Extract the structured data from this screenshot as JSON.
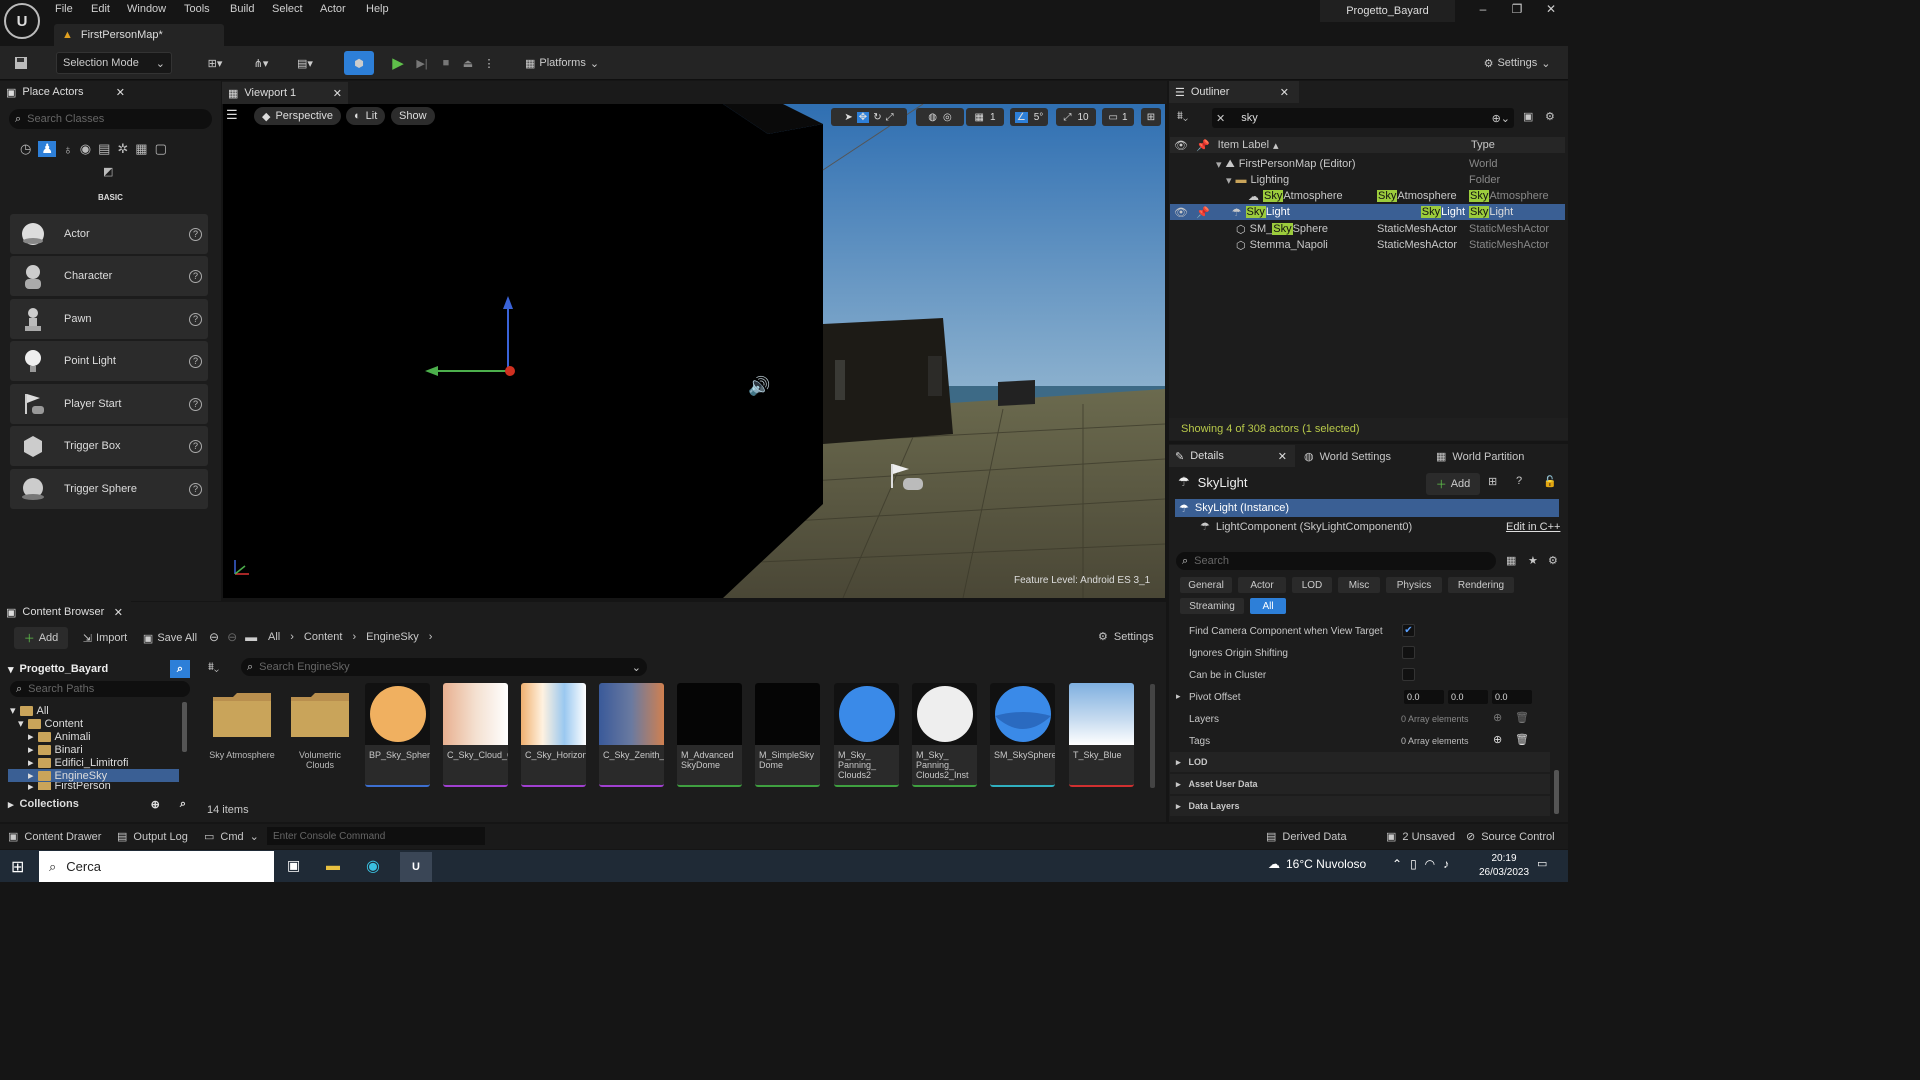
{
  "menu": [
    "File",
    "Edit",
    "Window",
    "Tools",
    "Build",
    "Select",
    "Actor",
    "Help"
  ],
  "project_name": "Progetto_Bayard",
  "map_tab": "FirstPersonMap*",
  "toolbar": {
    "selection_mode": "Selection Mode",
    "platforms": "Platforms",
    "settings": "Settings"
  },
  "place_actors": {
    "title": "Place Actors",
    "search_placeholder": "Search Classes",
    "category": "BASIC",
    "items": [
      {
        "label": "Actor"
      },
      {
        "label": "Character"
      },
      {
        "label": "Pawn"
      },
      {
        "label": "Point Light"
      },
      {
        "label": "Player Start"
      },
      {
        "label": "Trigger Box"
      },
      {
        "label": "Trigger Sphere"
      }
    ]
  },
  "viewport": {
    "tab": "Viewport 1",
    "perspective": "Perspective",
    "lit": "Lit",
    "show": "Show",
    "grid_value": "1",
    "angle_value": "5°",
    "scale_value": "10",
    "camera_value": "1",
    "feature_level": "Feature Level:  Android ES 3_1"
  },
  "outliner": {
    "title": "Outliner",
    "search_value": "sky",
    "col_label": "Item Label",
    "col_type": "Type",
    "rows": [
      {
        "pre": "",
        "hl": "",
        "post": "FirstPersonMap (Editor)",
        "type": "World",
        "tpre": "",
        "thl": "",
        "tpost": "World"
      },
      {
        "pre": "",
        "hl": "",
        "post": "Lighting",
        "type": "Folder",
        "tpre": "",
        "thl": "",
        "tpost": "Folder"
      },
      {
        "pre": "",
        "hl": "Sky",
        "post": "Atmosphere",
        "cls_hl": "Sky",
        "cls_post": "Atmosphere",
        "tpre": "",
        "thl": "Sky",
        "tpost": "Atmosphere"
      },
      {
        "pre": "",
        "hl": "Sky",
        "post": "Light",
        "cls_hl": "Sky",
        "cls_post": "Light",
        "tpre": "",
        "thl": "Sky",
        "tpost": "Light"
      },
      {
        "pre": "SM_",
        "hl": "Sky",
        "post": "Sphere",
        "cls": "StaticMeshActor",
        "tpost": "StaticMeshActor"
      },
      {
        "pre": "Stemma_Napoli",
        "hl": "",
        "post": "",
        "cls": "StaticMeshActor",
        "tpost": "StaticMeshActor"
      }
    ],
    "status": "Showing 4 of 308 actors (1 selected)"
  },
  "details": {
    "tab": "Details",
    "world_settings": "World Settings",
    "world_partition": "World Partition",
    "actor_name": "SkyLight",
    "add": "Add",
    "instance": "SkyLight (Instance)",
    "component": "LightComponent (SkyLightComponent0)",
    "edit_cpp": "Edit in C++",
    "search_placeholder": "Search",
    "filters": [
      "General",
      "Actor",
      "LOD",
      "Misc",
      "Physics",
      "Rendering",
      "Streaming",
      "All"
    ],
    "props": {
      "find_camera": "Find Camera Component when View Target",
      "ignores_origin": "Ignores Origin Shifting",
      "can_cluster": "Can be in Cluster",
      "pivot": "Pivot Offset",
      "layers": "Layers",
      "tags": "Tags",
      "array": "0 Array elements"
    },
    "pivot_values": [
      "0.0",
      "0.0",
      "0.0"
    ],
    "sections": [
      "LOD",
      "Asset User Data",
      "Data Layers"
    ]
  },
  "content_browser": {
    "title": "Content Browser",
    "add": "Add",
    "import": "Import",
    "save_all": "Save All",
    "path": [
      "All",
      "Content",
      "EngineSky"
    ],
    "settings": "Settings",
    "project": "Progetto_Bayard",
    "search_paths": "Search Paths",
    "search_assets": "Search EngineSky",
    "collections": "Collections",
    "item_count": "14 items",
    "tree": [
      "All",
      "Content",
      "Animali",
      "Binari",
      "Edifici_Limitrofi",
      "EngineSky",
      "FirstPerson"
    ],
    "folders": [
      {
        "name": "Sky Atmosphere"
      },
      {
        "name": "Volumetric Clouds"
      }
    ],
    "assets": [
      {
        "name": "BP_Sky_Sphere"
      },
      {
        "name": "C_Sky_Cloud_Color"
      },
      {
        "name": "C_Sky_Horizon_Color"
      },
      {
        "name": "C_Sky_Zenith_Color"
      },
      {
        "name": "M_Advanced SkyDome"
      },
      {
        "name": "M_SimpleSky Dome"
      },
      {
        "name": "M_Sky_ Panning_ Clouds2"
      },
      {
        "name": "M_Sky_ Panning_ Clouds2_Inst"
      },
      {
        "name": "SM_SkySphere"
      },
      {
        "name": "T_Sky_Blue"
      }
    ]
  },
  "statusbar": {
    "content_drawer": "Content Drawer",
    "output_log": "Output Log",
    "cmd": "Cmd",
    "console_placeholder": "Enter Console Command",
    "derived_data": "Derived Data",
    "unsaved": "2 Unsaved",
    "source_control": "Source Control"
  },
  "taskbar": {
    "search": "Cerca",
    "weather": "16°C  Nuvoloso",
    "time": "20:19",
    "date": "26/03/2023"
  }
}
